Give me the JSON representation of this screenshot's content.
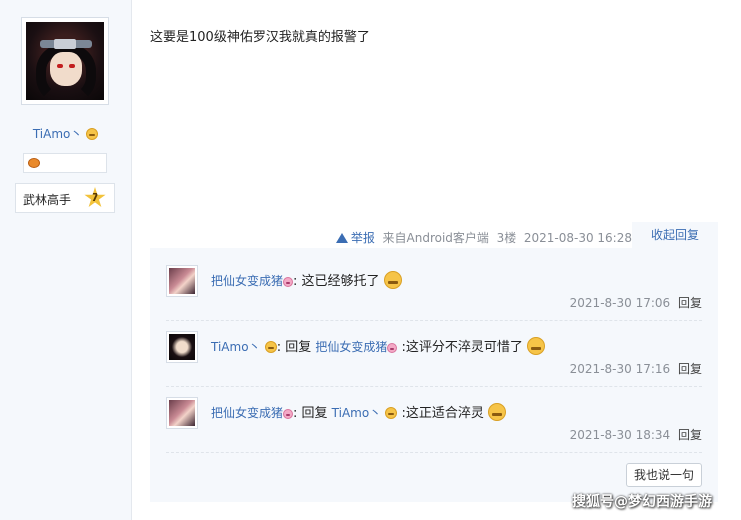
{
  "author": {
    "username": "TiAmo丶",
    "rank": "武林高手",
    "level_badge": "7"
  },
  "post": {
    "content": "这要是100级神佑罗汉我就真的报警了",
    "report_label": "举报",
    "source": "来自Android客户端",
    "floor": "3楼",
    "timestamp": "2021-08-30 16:28",
    "collapse_label": "收起回复"
  },
  "comments": [
    {
      "user": "把仙女变成猪",
      "prefix": "",
      "reply_to": "",
      "colon": ":",
      "text": " 这已经够托了",
      "time": "2021-8-30 17:06",
      "reply_label": "回复"
    },
    {
      "user": "TiAmo丶",
      "prefix": ": 回复 ",
      "reply_to": "把仙女变成猪",
      "colon": "",
      "text": " :这评分不淬灵可惜了",
      "time": "2021-8-30 17:16",
      "reply_label": "回复"
    },
    {
      "user": "把仙女变成猪",
      "prefix": ": 回复 ",
      "reply_to": "TiAmo丶",
      "colon": "",
      "text": " :这正适合淬灵",
      "time": "2021-8-30 18:34",
      "reply_label": "回复"
    }
  ],
  "say_button_label": "我也说一句",
  "watermark": "搜狐号@梦幻西游手游",
  "colors": {
    "link": "#3b6db3",
    "sidebar_bg": "#f5f8fc",
    "meta_text": "#8a8f97"
  }
}
